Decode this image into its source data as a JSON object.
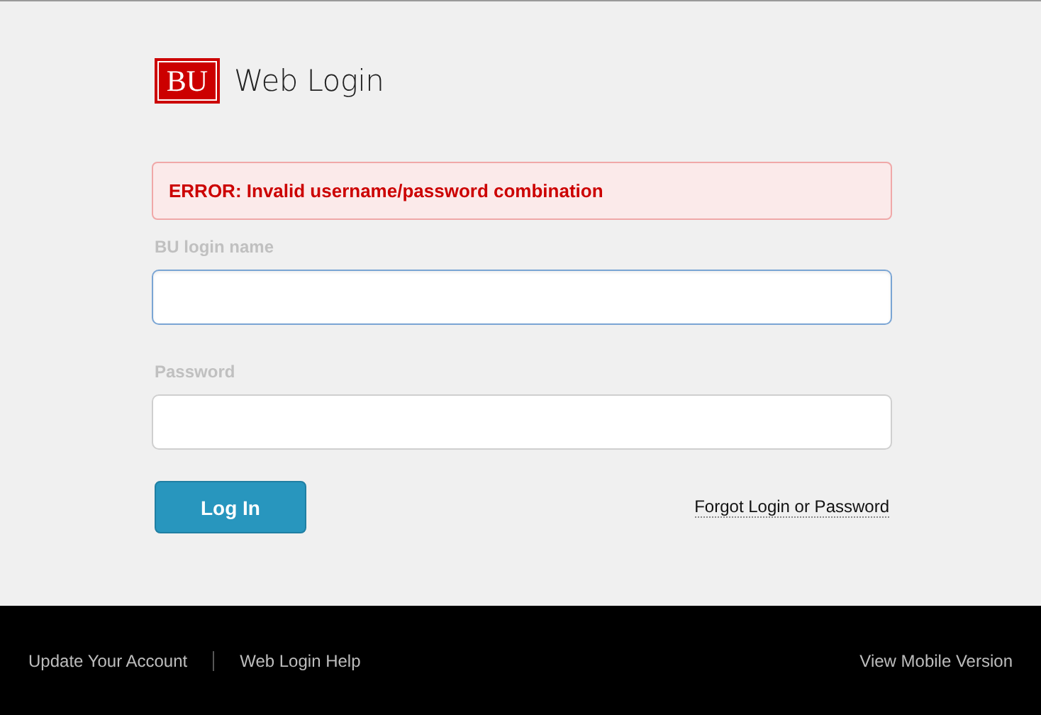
{
  "logo": {
    "mark": "BU",
    "title": "Web Login"
  },
  "error": "ERROR: Invalid username/password combination",
  "fields": [
    {
      "label": "BU login name",
      "focused": true
    },
    {
      "label": "Password",
      "focused": false
    }
  ],
  "login_button": "Log In",
  "forgot_link": "Forgot Login or Password",
  "footer": {
    "left_links": [
      "Update Your Account",
      "Web Login Help"
    ],
    "right_link": "View Mobile Version"
  }
}
